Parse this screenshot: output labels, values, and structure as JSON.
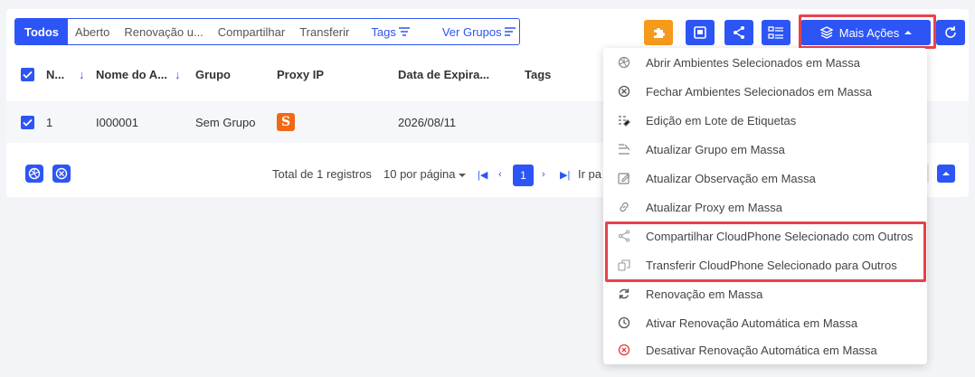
{
  "tabs": [
    {
      "label": "Todos",
      "active": true
    },
    {
      "label": "Aberto"
    },
    {
      "label": "Renovação u..."
    },
    {
      "label": "Compartilhar"
    },
    {
      "label": "Transferir"
    },
    {
      "label": "Tags"
    },
    {
      "label": "Ver Grupos"
    }
  ],
  "toolbar": {
    "more_actions_label": "Mais Ações",
    "icons": [
      "puzzle-icon",
      "save-icon",
      "share-icon",
      "list-icon",
      "layers-icon",
      "refresh-icon"
    ]
  },
  "table": {
    "headers": [
      "N...",
      "Nome do A...",
      "Grupo",
      "Proxy IP",
      "Data de Expira...",
      "Tags"
    ],
    "rows": [
      {
        "num": "1",
        "name": "I000001",
        "group": "Sem Grupo",
        "proxy_badge": "S",
        "expiry": "2026/08/11",
        "tags": ""
      }
    ]
  },
  "footer": {
    "total": "Total de 1 registros",
    "per_page": "10 por página",
    "current_page": "1",
    "goto": "Ir pa"
  },
  "menu": {
    "items": [
      {
        "label": "Abrir Ambientes Selecionados em Massa",
        "icon": "aperture-icon"
      },
      {
        "label": "Fechar Ambientes Selecionados em Massa",
        "icon": "close-circle-icon"
      },
      {
        "label": "Edição em Lote de Etiquetas",
        "icon": "tags-icon"
      },
      {
        "label": "Atualizar Grupo em Massa",
        "icon": "group-icon"
      },
      {
        "label": "Atualizar Observação em Massa",
        "icon": "edit-icon"
      },
      {
        "label": "Atualizar Proxy em Massa",
        "icon": "link-icon"
      },
      {
        "label": "Compartilhar CloudPhone Selecionado com Outros",
        "icon": "share-icon"
      },
      {
        "label": "Transferir CloudPhone Selecionado para Outros",
        "icon": "transfer-icon"
      },
      {
        "label": "Renovação em Massa",
        "icon": "renew-icon"
      },
      {
        "label": "Ativar Renovação Automática em Massa",
        "icon": "clock-icon"
      },
      {
        "label": "Desativar Renovação Automática em Massa",
        "icon": "disable-icon"
      }
    ]
  },
  "colors": {
    "primary": "#2d55f5",
    "orange": "#f59a1b",
    "highlight": "#e8424a",
    "badge": "#f06a16"
  }
}
